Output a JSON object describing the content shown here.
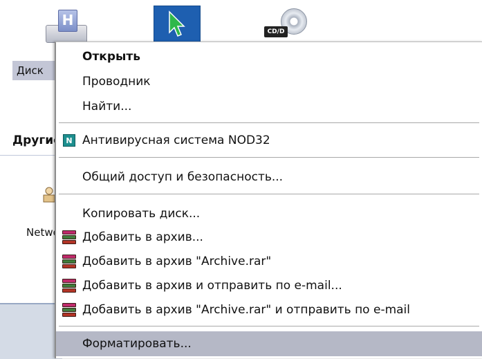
{
  "desktop": {
    "disk_label": "Диск",
    "other_places_label": "Другие",
    "network_label": "Network",
    "cd_tag": "CD/D"
  },
  "context_menu": {
    "items": [
      {
        "label": "Открыть",
        "bold": true
      },
      {
        "label": "Проводник"
      },
      {
        "label": "Найти..."
      },
      {
        "label": "Антивирусная система NOD32",
        "icon": "nod32-icon"
      },
      {
        "label": "Общий доступ и безопасность..."
      },
      {
        "label": "Копировать диск..."
      },
      {
        "label": "Добавить в архив...",
        "icon": "winrar-icon"
      },
      {
        "label": "Добавить в архив \"Archive.rar\"",
        "icon": "winrar-icon"
      },
      {
        "label": "Добавить в архив и отправить по e-mail...",
        "icon": "winrar-icon"
      },
      {
        "label": "Добавить в архив \"Archive.rar\" и отправить по e-mail",
        "icon": "winrar-icon"
      },
      {
        "label": "Форматировать...",
        "highlighted": true
      }
    ]
  },
  "colors": {
    "highlight": "#b5b8c6",
    "nod32": "#1d8f8f",
    "taskbar": "#d4dbe6"
  }
}
